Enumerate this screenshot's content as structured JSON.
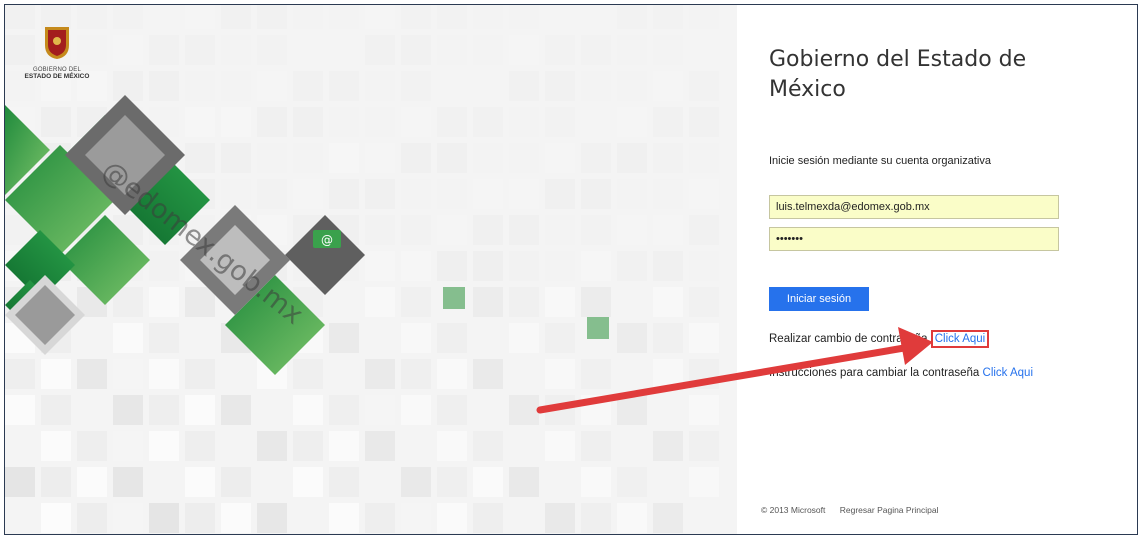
{
  "brand": {
    "line1": "GOBIERNO DEL",
    "line2": "ESTADO DE MÉXICO",
    "watermark": "@edomex.gob.mx"
  },
  "login": {
    "title": "Gobierno del Estado de México",
    "subtitle": "Inicie sesión mediante su cuenta organizativa",
    "username_value": "luis.telmexda@edomex.gob.mx",
    "password_mask": "•••••••",
    "submit_label": "Iniciar sesión"
  },
  "links": {
    "change_password_text": "Realizar cambio de contraseña",
    "change_password_link": "Click Aqui",
    "instructions_text": "Instrucciones para cambiar la contraseña",
    "instructions_link": "Click Aqui"
  },
  "footer": {
    "copyright": "© 2013 Microsoft",
    "home_link": "Regresar Pagina Principal"
  },
  "colors": {
    "accent": "#2672ec",
    "autofill": "#fafdc8",
    "highlight": "#e03b3b",
    "green": "#3a9a4a"
  }
}
